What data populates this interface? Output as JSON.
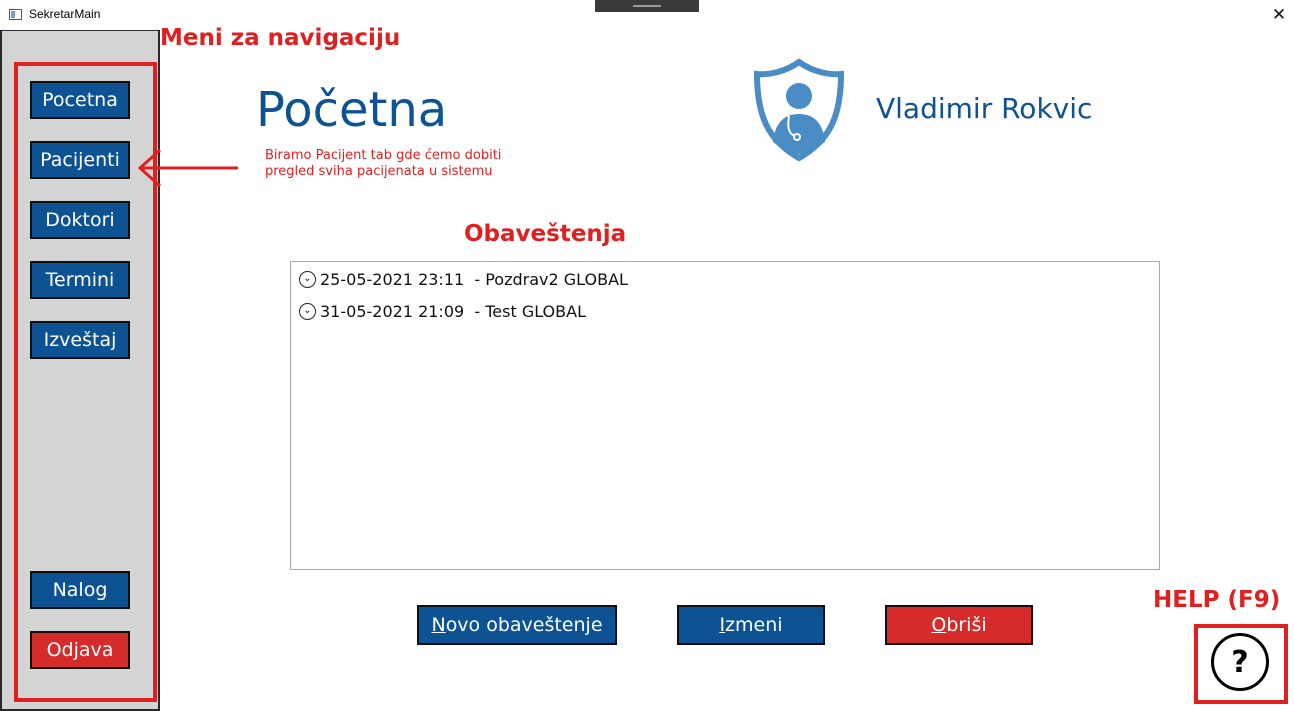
{
  "window": {
    "title": "SekretarMain",
    "close_glyph": "✕"
  },
  "sidebar": {
    "items": [
      {
        "label": "Pocetna"
      },
      {
        "label": "Pacijenti"
      },
      {
        "label": "Doktori"
      },
      {
        "label": "Termini"
      },
      {
        "label": "Izveštaj"
      }
    ],
    "bottom": [
      {
        "label": "Nalog"
      },
      {
        "label": "Odjava"
      }
    ]
  },
  "annotations": {
    "nav_menu": "Meni za navigaciju",
    "pacijenti_note": "Biramo Pacijent tab gde ćemo dobiti pregled sviha pacijenata u sistemu",
    "notifications_heading": "Obaveštenja",
    "help": "HELP (F9)"
  },
  "main": {
    "title": "Početna",
    "user_name": "Vladimir Rokvic",
    "notifications": [
      {
        "date": "25-05-2021 23:11",
        "text": "  - Pozdrav2 GLOBAL"
      },
      {
        "date": "31-05-2021 21:09",
        "text": "  - Test GLOBAL"
      }
    ],
    "buttons": {
      "new": {
        "mnemonic": "N",
        "rest": "ovo obaveštenje"
      },
      "edit": {
        "mnemonic": "I",
        "rest": "zmeni"
      },
      "delete": {
        "mnemonic": "O",
        "rest": "briši"
      }
    }
  },
  "help": {
    "glyph": "?"
  },
  "colors": {
    "primary": "#0d5292",
    "danger": "#d52b2b",
    "annotation": "#e02020",
    "sidebar_bg": "#d4d4d4"
  }
}
